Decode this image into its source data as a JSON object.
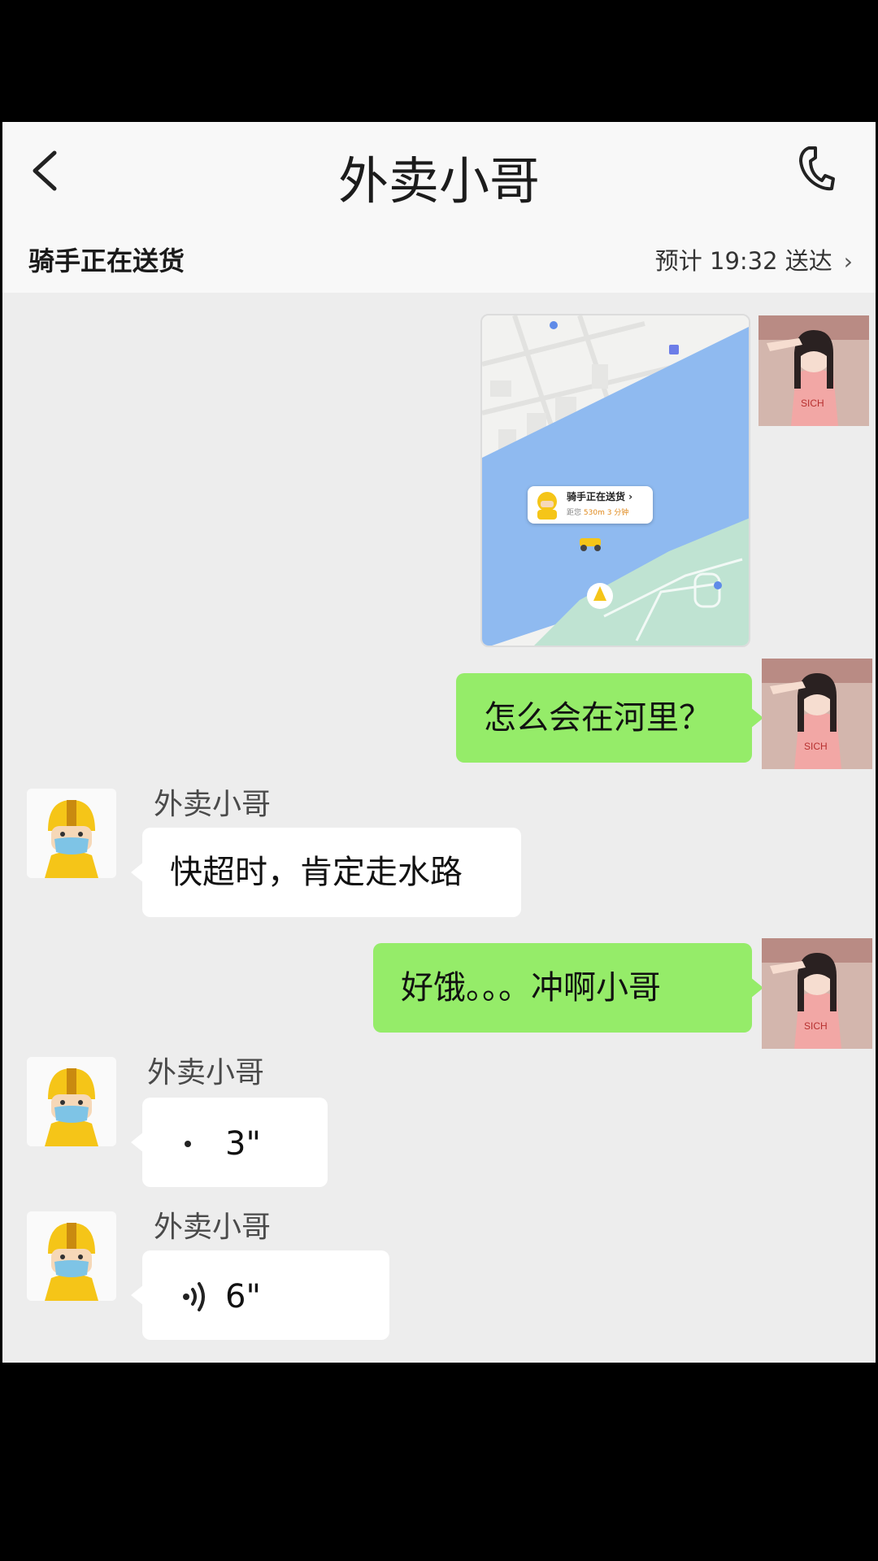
{
  "header": {
    "title": "外卖小哥",
    "status_text": "骑手正在送货",
    "eta_text": "预计 19:32 送达",
    "eta_chevron": "›"
  },
  "map_card": {
    "title": "骑手正在送货 ›",
    "sub_prefix": "距您",
    "distance": "530m",
    "time": "3 分钟"
  },
  "messages": [
    {
      "from": "me",
      "type": "image",
      "avatar": "girl-avatar"
    },
    {
      "from": "me",
      "type": "text",
      "text": "怎么会在河里？"
    },
    {
      "from": "them",
      "sender": "外卖小哥",
      "type": "text",
      "text": "快超时，肯定走水路"
    },
    {
      "from": "me",
      "type": "text",
      "text": "好饿。。。冲啊小哥"
    },
    {
      "from": "them",
      "sender": "外卖小哥",
      "type": "voice",
      "duration": "3\""
    },
    {
      "from": "them",
      "sender": "外卖小哥",
      "type": "voice",
      "duration": "6\""
    }
  ],
  "icons": {
    "back": "chevron-left-icon",
    "call": "phone-icon",
    "voice": "voice-wave-icon"
  },
  "colors": {
    "my_bubble": "#95ec69",
    "their_bubble": "#ffffff",
    "chat_bg": "#ededed",
    "header_bg": "#f8f8f8",
    "map_water": "#8fbaf0",
    "map_land": "#f2f2f0",
    "map_park": "#bfe3d2",
    "helmet": "#f5c518"
  }
}
